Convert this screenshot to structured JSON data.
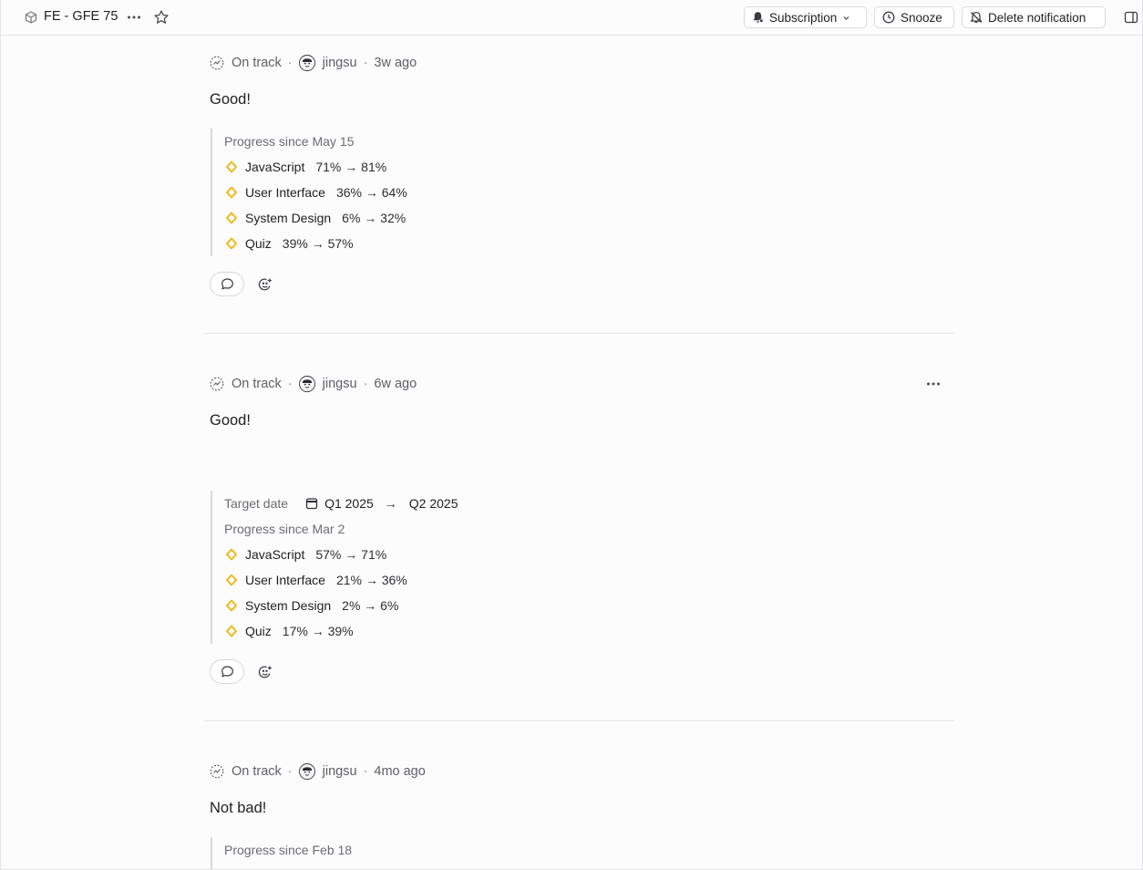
{
  "header": {
    "project_title": "FE - GFE 75",
    "subscription_label": "Subscription",
    "snooze_label": "Snooze",
    "delete_label": "Delete notification"
  },
  "updates": [
    {
      "status": "On track",
      "author": "jingsu",
      "time": "3w ago",
      "text": "Good!",
      "progress_label": "Progress since May 15",
      "skills": [
        {
          "name": "JavaScript",
          "change": "71% → 81%"
        },
        {
          "name": "User Interface",
          "change": "36% → 64%"
        },
        {
          "name": "System Design",
          "change": "6% → 32%"
        },
        {
          "name": "Quiz",
          "change": "39% → 57%"
        }
      ]
    },
    {
      "status": "On track",
      "author": "jingsu",
      "time": "6w ago",
      "text": "Good!",
      "target_label": "Target date",
      "target_from": "Q1 2025",
      "target_arrow": "→",
      "target_to": "Q2 2025",
      "progress_label": "Progress since Mar 2",
      "skills": [
        {
          "name": "JavaScript",
          "change": "57% → 71%"
        },
        {
          "name": "User Interface",
          "change": "21% → 36%"
        },
        {
          "name": "System Design",
          "change": "2% → 6%"
        },
        {
          "name": "Quiz",
          "change": "17% → 39%"
        }
      ]
    },
    {
      "status": "On track",
      "author": "jingsu",
      "time": "4mo ago",
      "text": "Not bad!",
      "progress_label": "Progress since Feb 18"
    }
  ],
  "colors": {
    "accent_diamond": "#f0b400",
    "divider": "#e6e6e8",
    "muted_text": "#5e5e66"
  },
  "icons": {
    "project": "cube-icon",
    "more": "more-horizontal-icon",
    "star": "star-icon",
    "subscription": "bell-icon",
    "snooze": "clock-icon",
    "delete": "bell-off-icon",
    "panel": "side-panel-icon",
    "status": "on-track-icon",
    "skill": "diamond-icon",
    "comment": "comment-icon",
    "reaction": "add-reaction-icon",
    "calendar": "calendar-icon"
  }
}
